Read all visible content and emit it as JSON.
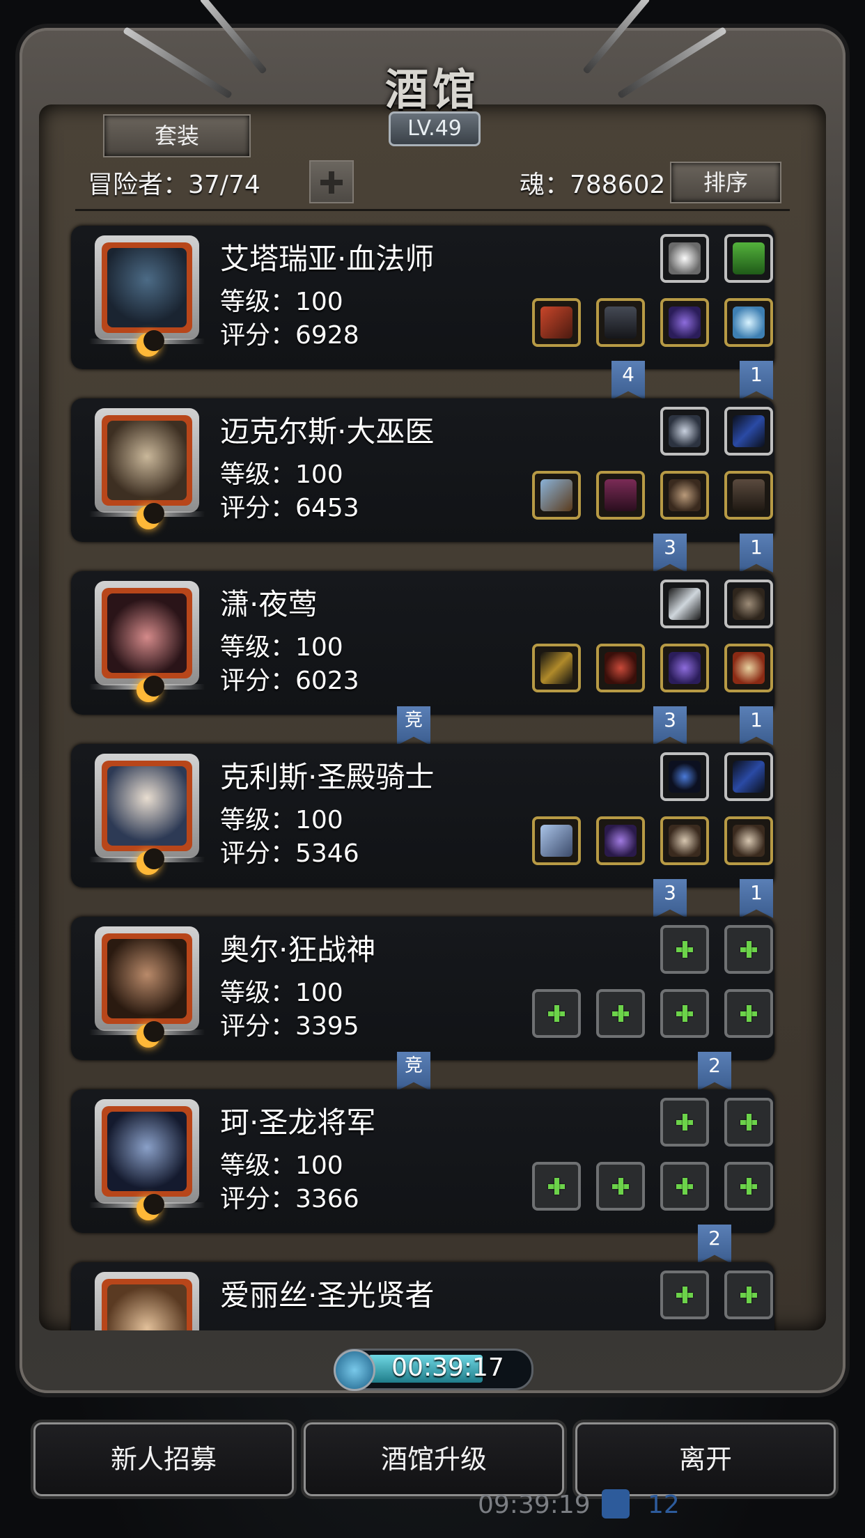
{
  "title": "酒馆",
  "level": "LV.49",
  "set_button": "套装",
  "adventurers_label": "冒险者：37/74",
  "soul_label": "魂：788602",
  "sort_button": "排序",
  "heroes": [
    {
      "name": "艾塔瑞亚·血法师",
      "level": "等级：100",
      "score": "评分：6928"
    },
    {
      "name": "迈克尔斯·大巫医",
      "level": "等级：100",
      "score": "评分：6453"
    },
    {
      "name": "潇·夜莺",
      "level": "等级：100",
      "score": "评分：6023"
    },
    {
      "name": "克利斯·圣殿骑士",
      "level": "等级：100",
      "score": "评分：5346"
    },
    {
      "name": "奥尔·狂战神",
      "level": "等级：100",
      "score": "评分：3395"
    },
    {
      "name": "珂·圣龙将军",
      "level": "等级：100",
      "score": "评分：3366"
    },
    {
      "name": "爱丽丝·圣光贤者",
      "level": "",
      "score": ""
    }
  ],
  "flags": [
    "4",
    "1",
    "3",
    "1",
    "竞",
    "3",
    "1",
    "3",
    "1",
    "竞",
    "2",
    "2"
  ],
  "timer": "00:39:17",
  "buttons": {
    "recruit": "新人招募",
    "upgrade": "酒馆升级",
    "leave": "离开"
  },
  "background_time": "09:39:19",
  "background_count": "12",
  "colors": {
    "flag": "#4a6ea3",
    "gold_slot": "#b79a45",
    "plus": "#6cd34a"
  }
}
